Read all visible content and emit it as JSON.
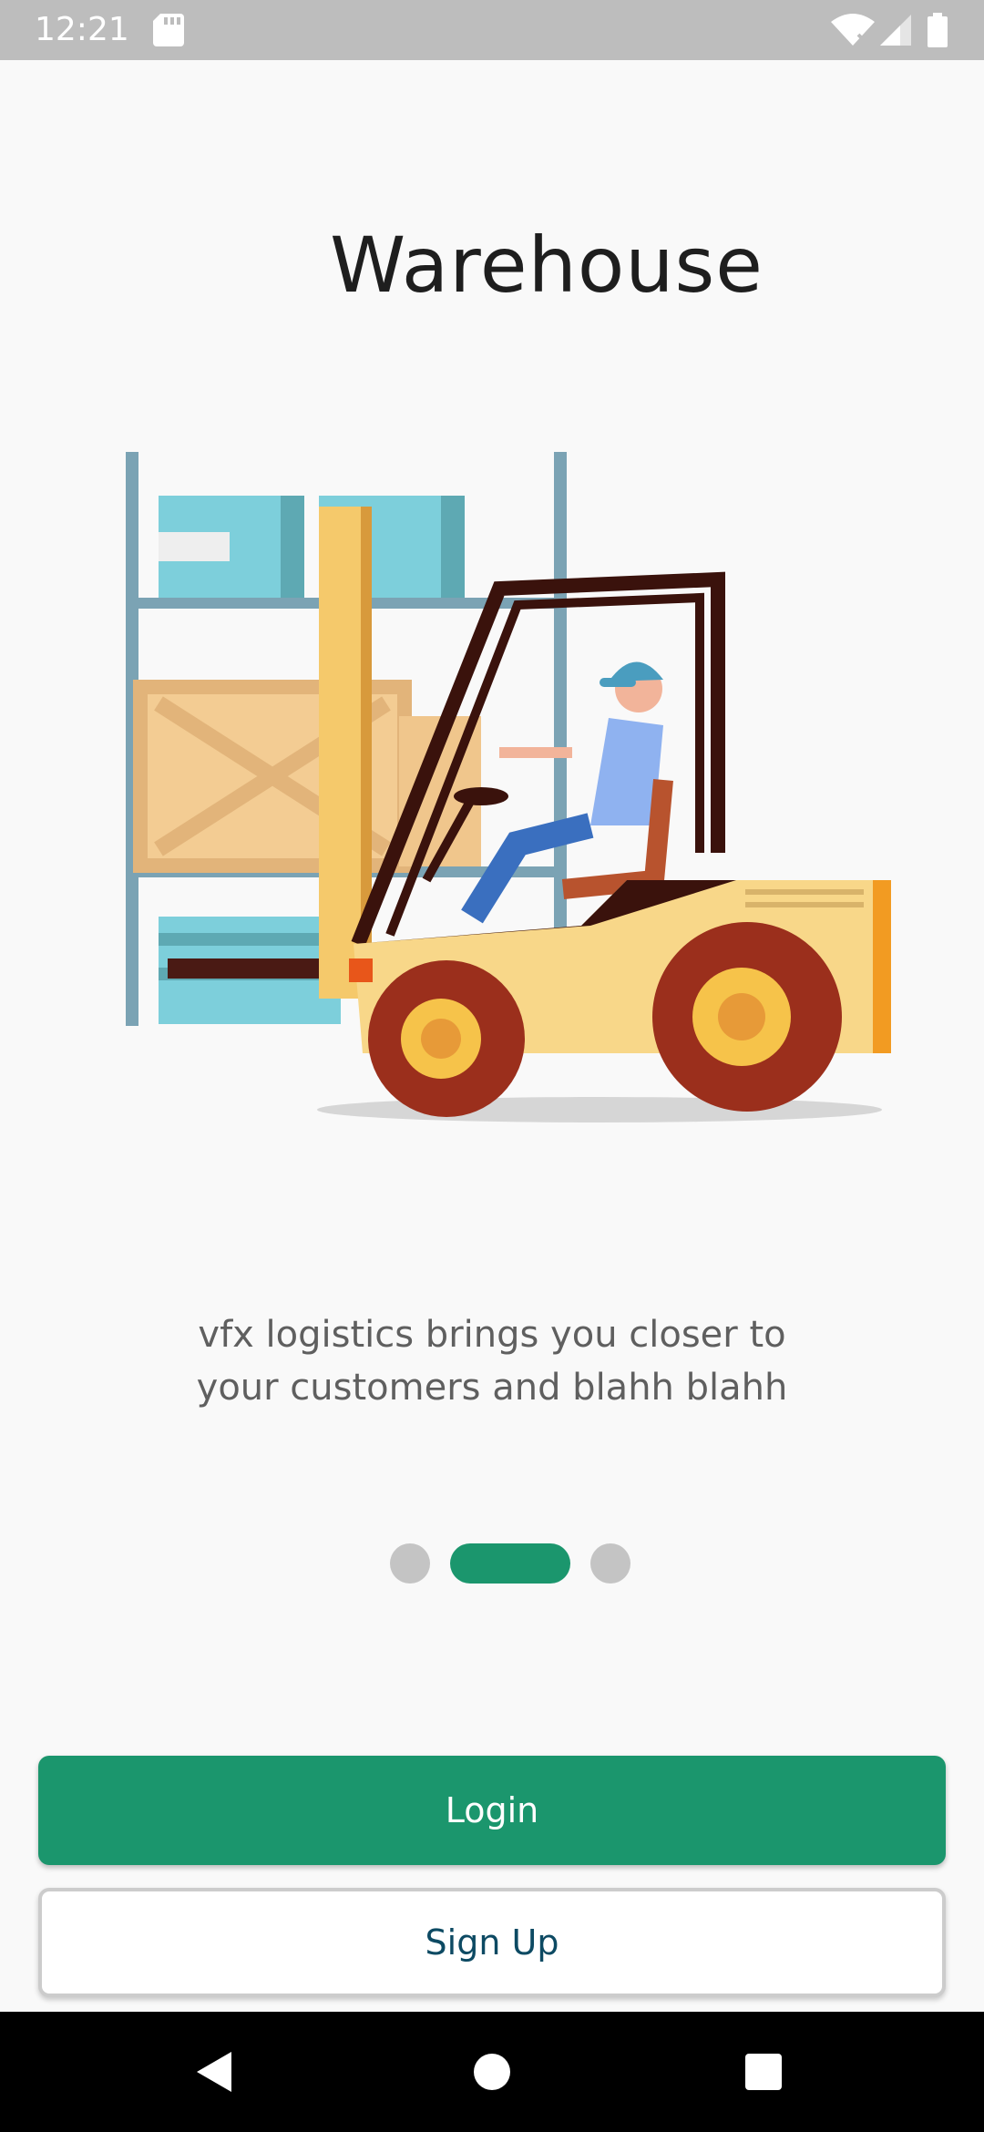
{
  "status_bar": {
    "time": "12:21",
    "icons": [
      "sd-card-icon",
      "wifi-icon",
      "signal-icon",
      "battery-icon"
    ]
  },
  "onboarding": {
    "title": "Warehouse",
    "illustration": "forklift-warehouse-illustration",
    "description_line1": "vfx logistics brings you closer to",
    "description_line2": "your customers and blahh blahh",
    "pager": {
      "total": 3,
      "active_index": 1
    }
  },
  "actions": {
    "login_label": "Login",
    "signup_label": "Sign Up"
  },
  "nav_bar": {
    "icons": [
      "back-icon",
      "home-icon",
      "recents-icon"
    ]
  },
  "colors": {
    "accent": "#1b966d",
    "signup_text": "#0d4a63",
    "status_bar": "#bdbdbd",
    "background": "#f9f9f9"
  }
}
